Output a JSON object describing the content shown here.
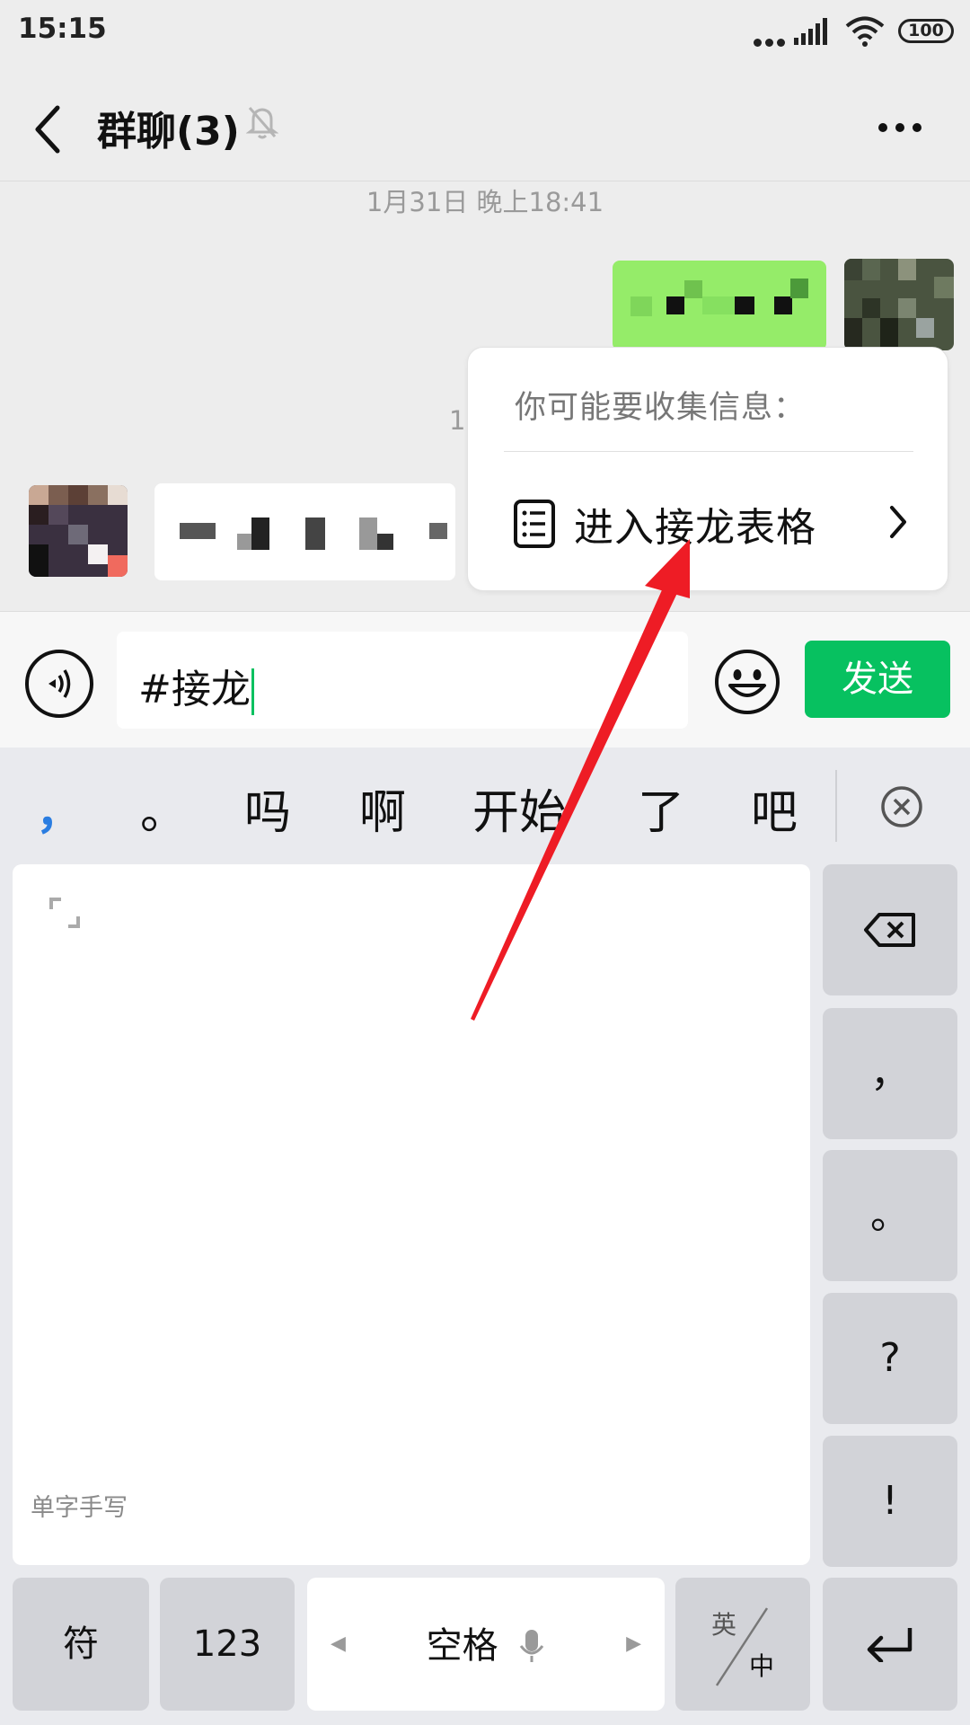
{
  "status_bar": {
    "time": "15:15",
    "battery": "100"
  },
  "header": {
    "title": "群聊(3)"
  },
  "chat": {
    "timestamp": "1月31日 晚上18:41",
    "timestamp_partial": "1"
  },
  "suggestion": {
    "hint": "你可能要收集信息：",
    "action": "进入接龙表格"
  },
  "input": {
    "text": "#接龙",
    "send_label": "发送"
  },
  "keyboard": {
    "candidates": [
      "，",
      "。",
      "吗",
      "啊",
      "开始",
      "了",
      "吧"
    ],
    "pad_label": "单字手写",
    "side_keys": {
      "comma": "，",
      "period": "。",
      "question": "?",
      "exclaim": "!"
    },
    "bottom_keys": {
      "symbol": "符",
      "number": "123",
      "space": "空格",
      "lang_en": "英",
      "lang_zh": "中"
    }
  },
  "colors": {
    "wechat_green": "#07c160",
    "sent_bubble": "#95ec69",
    "annotation_red": "#ee1c25"
  }
}
